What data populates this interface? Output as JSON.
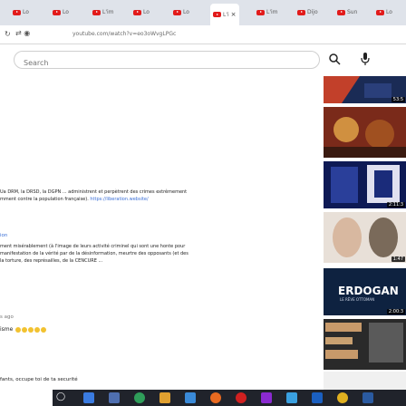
{
  "tabs": [
    {
      "label": "Lo"
    },
    {
      "label": "Lo"
    },
    {
      "label": "L'im"
    },
    {
      "label": "Lo"
    },
    {
      "label": "Lo"
    },
    {
      "label": "L'i"
    },
    {
      "label": "L'im"
    },
    {
      "label": "Dijo"
    },
    {
      "label": "Sun"
    },
    {
      "label": "Lo"
    }
  ],
  "address_bar": {
    "url": "youtube.com/watch?v=eo3oWvgLPGc"
  },
  "header": {
    "search_placeholder": "Search"
  },
  "description": {
    "line1": "Ua  DRM, la DRSD, la DGPN ... administrent et perpètrent des crimes extrêmement",
    "line2a": "mment contre la population française). ",
    "line2_link": "https://liberation.website/",
    "tag": "ion",
    "p3": "ment misérablement (à l'image de leurs activité criminel qui sont une honte pour",
    "p4": "manifestation de la vérité par de la désinformation, meurtre des opposants (et des",
    "p5": "la torture, des représailles, de la CENCURE ...",
    "time": "s ago",
    "emoji_prefix": "isme",
    "bottom": "fants, occupe toi de ta securité"
  },
  "related": [
    {
      "duration": "53:5",
      "colors": [
        "#c2402a",
        "#1a2b55"
      ]
    },
    {
      "duration": "",
      "colors": [
        "#7a2a1a",
        "#d09040"
      ]
    },
    {
      "duration": "2:11:3",
      "colors": [
        "#1a2b7a",
        "#e0e0f0"
      ]
    },
    {
      "duration": "1:47",
      "colors": [
        "#d8c0b0",
        "#7a6a5a"
      ]
    },
    {
      "title": "ERDOGAN",
      "subtitle": "LE RÊVE OTTOMAN",
      "duration": "2:00:3",
      "colors": [
        "#0e2240",
        "#1c3a6a"
      ]
    },
    {
      "duration": "",
      "colors": [
        "#c89a6a",
        "#3a3a3a"
      ]
    }
  ],
  "taskbar": {
    "icons": [
      "windows-icon",
      "search-icon",
      "task-view-icon",
      "chrome-icon",
      "files-icon",
      "store-icon",
      "firefox-icon",
      "opera-icon",
      "media-icon",
      "app-icon",
      "dropbox-icon",
      "chrome-icon",
      "word-icon"
    ]
  }
}
